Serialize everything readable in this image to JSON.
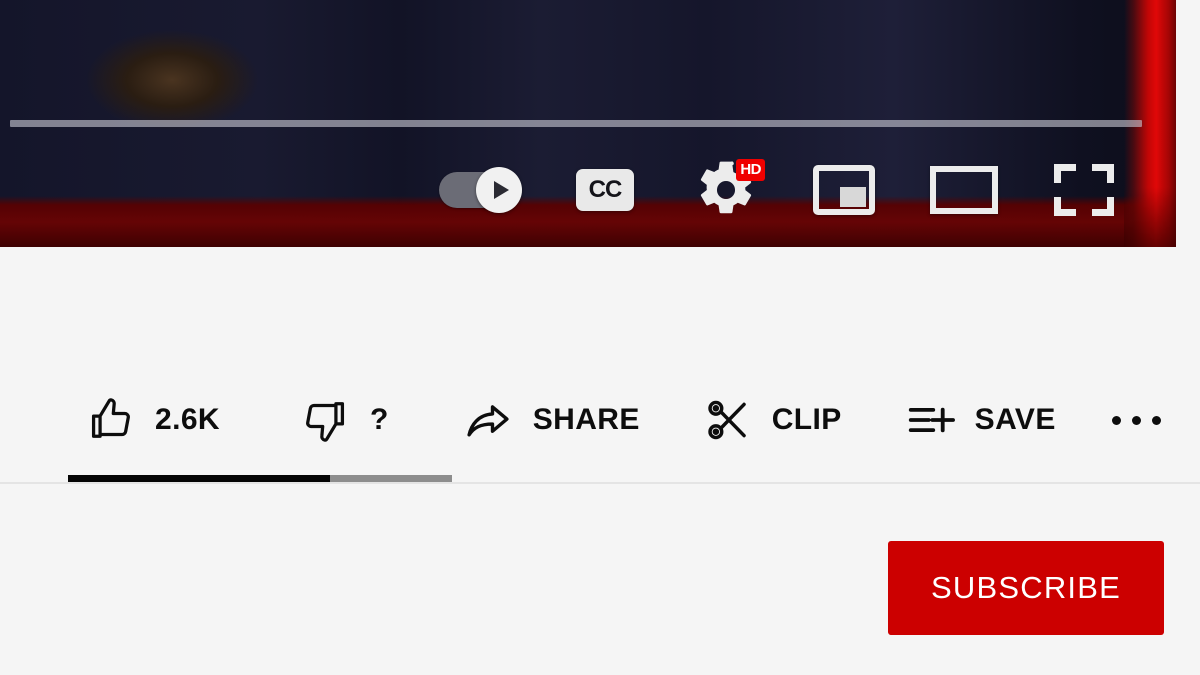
{
  "player": {
    "progress_bar": {
      "name": "video-progress-bar"
    },
    "controls": [
      {
        "id": "autoplay",
        "label": "Autoplay",
        "icon": "autoplay-toggle-icon",
        "state": "on"
      },
      {
        "id": "captions",
        "label": "CC",
        "icon": "closed-captions-icon",
        "state": "on"
      },
      {
        "id": "settings",
        "label": "Settings",
        "icon": "gear-icon",
        "badge": "HD"
      },
      {
        "id": "miniplayer",
        "label": "Miniplayer",
        "icon": "miniplayer-icon"
      },
      {
        "id": "theater",
        "label": "Theater mode",
        "icon": "theater-mode-icon"
      },
      {
        "id": "fullscreen",
        "label": "Full screen",
        "icon": "fullscreen-icon"
      }
    ],
    "colors": {
      "accent_red": "#ef0000",
      "control_light": "#ececec",
      "toggle_track": "#6b6c76"
    }
  },
  "actions": [
    {
      "id": "like",
      "icon": "thumbs-up-icon",
      "label": "2.6K"
    },
    {
      "id": "dislike",
      "icon": "thumbs-down-icon",
      "label": "?"
    },
    {
      "id": "share",
      "icon": "share-arrow-icon",
      "label": "SHARE"
    },
    {
      "id": "clip",
      "icon": "scissors-icon",
      "label": "CLIP"
    },
    {
      "id": "save",
      "icon": "save-list-plus-icon",
      "label": "SAVE"
    },
    {
      "id": "more",
      "icon": "more-horizontal-icon",
      "label": ""
    }
  ],
  "scrollbar": {
    "name": "action-bar-scrollbar",
    "thumb_color": "#050505",
    "track_color": "#8d8d8d"
  },
  "subscribe": {
    "label": "SUBSCRIBE",
    "color": "#cc0000",
    "text_color": "#ffffff"
  }
}
